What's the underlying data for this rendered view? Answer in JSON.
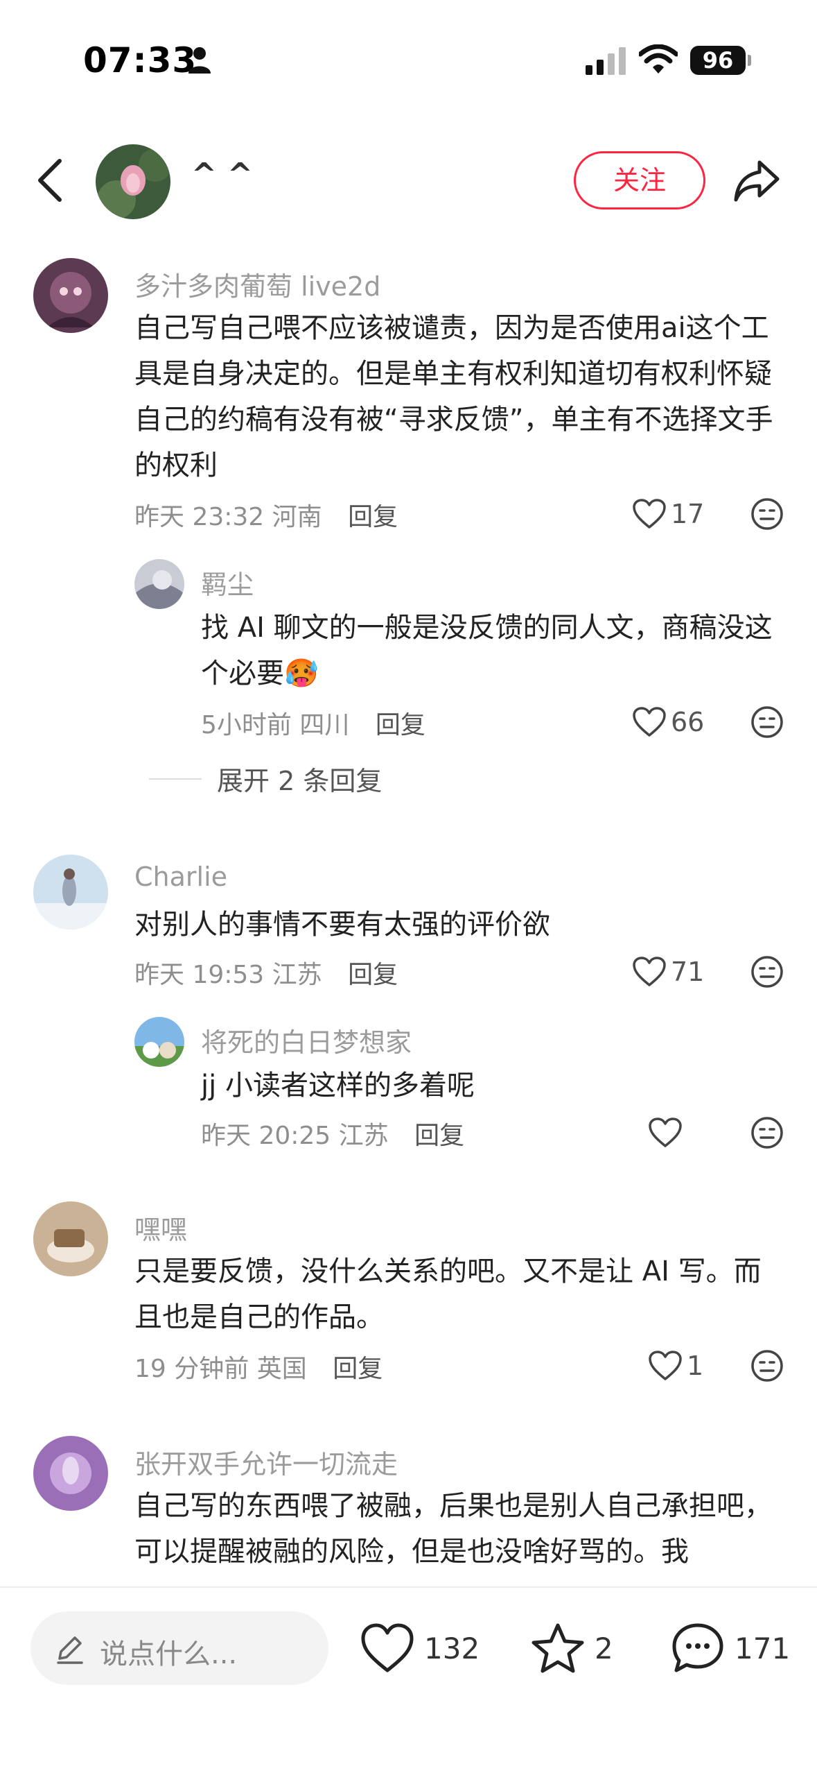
{
  "status_bar": {
    "time": "07:33",
    "battery": "96"
  },
  "header": {
    "name": "^ ^",
    "follow_label": "关注"
  },
  "comments": [
    {
      "user": "多汁多肉葡萄 live2d",
      "text": "自己写自己喂不应该被谴责，因为是否使用ai这个工具是自身决定的。但是单主有权利知道切有权利怀疑自己的约稿有没有被“寻求反馈”，单主有不选择文手的权利",
      "time": "昨天 23:32",
      "location": "河南",
      "reply_label": "回复",
      "likes": "17",
      "replies": [
        {
          "user": "羁尘",
          "text": "找 AI 聊文的一般是没反馈的同人文，商稿没这个必要🥵",
          "time": "5小时前",
          "location": "四川",
          "reply_label": "回复",
          "likes": "66"
        }
      ],
      "expand_label": "展开 2 条回复"
    },
    {
      "user": "Charlie",
      "text": "对别人的事情不要有太强的评价欲",
      "time": "昨天 19:53",
      "location": "江苏",
      "reply_label": "回复",
      "likes": "71",
      "replies": [
        {
          "user": "将死的白日梦想家",
          "text": "jj 小读者这样的多着呢",
          "time": "昨天 20:25",
          "location": "江苏",
          "reply_label": "回复",
          "likes": ""
        }
      ]
    },
    {
      "user": "嘿嘿",
      "text": "只是要反馈，没什么关系的吧。又不是让 AI 写。而且也是自己的作品。",
      "time": "19 分钟前",
      "location": "英国",
      "reply_label": "回复",
      "likes": "1"
    },
    {
      "user": "张开双手允许一切流走",
      "text": "自己写的东西喂了被融，后果也是别人自己承担吧，可以提醒被融的风险，但是也没啥好骂的。我"
    }
  ],
  "bottom_bar": {
    "input_placeholder": "说点什么...",
    "likes": "132",
    "favorites": "2",
    "comments": "171"
  },
  "colors": {
    "accent": "#ff2442",
    "muted_text": "#9b9b9b"
  },
  "icons": [
    "person-icon",
    "signal-icon",
    "wifi-icon",
    "back-icon",
    "share-icon",
    "heart-icon",
    "emoji-icon",
    "pencil-icon",
    "star-icon",
    "chat-bubble-icon"
  ]
}
